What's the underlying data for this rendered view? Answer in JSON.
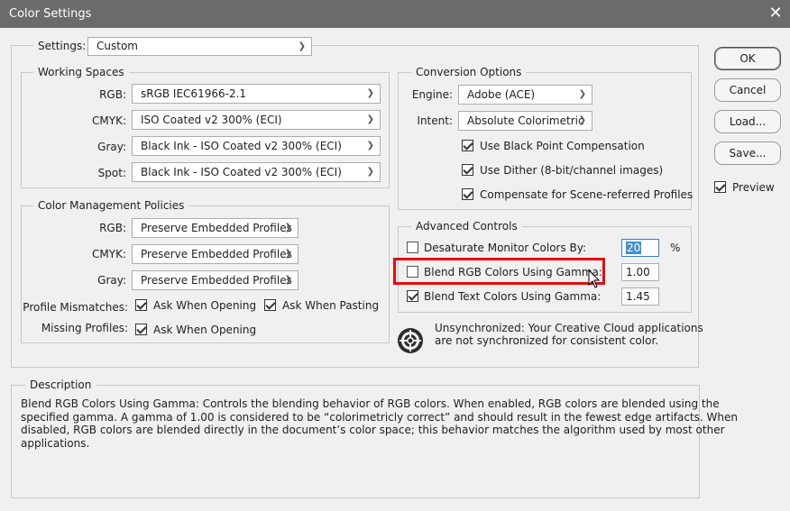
{
  "window": {
    "title": "Color Settings",
    "close_glyph": "✕"
  },
  "settings": {
    "label": "Settings:",
    "value": "Custom"
  },
  "working_spaces": {
    "legend": "Working Spaces",
    "rgb": {
      "label": "RGB:",
      "value": "sRGB IEC61966-2.1"
    },
    "cmyk": {
      "label": "CMYK:",
      "value": "ISO Coated v2 300% (ECI)"
    },
    "gray": {
      "label": "Gray:",
      "value": "Black Ink - ISO Coated v2 300% (ECI)"
    },
    "spot": {
      "label": "Spot:",
      "value": "Black Ink - ISO Coated v2 300% (ECI)"
    }
  },
  "policies": {
    "legend": "Color Management Policies",
    "rgb": {
      "label": "RGB:",
      "value": "Preserve Embedded Profiles"
    },
    "cmyk": {
      "label": "CMYK:",
      "value": "Preserve Embedded Profiles"
    },
    "gray": {
      "label": "Gray:",
      "value": "Preserve Embedded Profiles"
    },
    "mismatch_label": "Profile Mismatches:",
    "ask_opening": {
      "label": "Ask When Opening",
      "checked": true
    },
    "ask_pasting": {
      "label": "Ask When Pasting",
      "checked": true
    },
    "missing_label": "Missing Profiles:",
    "missing_opening": {
      "label": "Ask When Opening",
      "checked": true
    }
  },
  "conversion": {
    "legend": "Conversion Options",
    "engine": {
      "label": "Engine:",
      "value": "Adobe (ACE)"
    },
    "intent": {
      "label": "Intent:",
      "value": "Absolute Colorimetric"
    },
    "black_point": {
      "label": "Use Black Point Compensation",
      "checked": true
    },
    "dither": {
      "label": "Use Dither (8-bit/channel images)",
      "checked": true
    },
    "scene": {
      "label": "Compensate for Scene-referred Profiles",
      "checked": true
    }
  },
  "advanced": {
    "legend": "Advanced Controls",
    "desaturate": {
      "label": "Desaturate Monitor Colors By:",
      "checked": false,
      "value": "20",
      "unit": "%"
    },
    "blend_rgb": {
      "label": "Blend RGB Colors Using Gamma:",
      "checked": false,
      "value": "1.00"
    },
    "blend_text": {
      "label": "Blend Text Colors Using Gamma:",
      "checked": true,
      "value": "1.45"
    }
  },
  "sync": {
    "line1": "Unsynchronized: Your Creative Cloud applications",
    "line2": "are not synchronized for consistent color.",
    "icon": "sync-status-icon"
  },
  "buttons": {
    "ok": "OK",
    "cancel": "Cancel",
    "load": "Load...",
    "save": "Save..."
  },
  "preview": {
    "label": "Preview",
    "checked": true
  },
  "description": {
    "legend": "Description",
    "line1": "Blend RGB Colors Using Gamma:  Controls the blending behavior of RGB colors.  When enabled, RGB colors are blended using the",
    "line2": "specified gamma.  A gamma of 1.00 is considered to be “colorimetricly correct” and should result in the fewest edge artifacts.  When",
    "line3": "disabled, RGB colors are blended directly in the document’s color space; this behavior matches the algorithm used by most other",
    "line4": "applications."
  },
  "colors": {
    "titlebar": "#6b6b6b",
    "highlight": "#e20d0d",
    "selection": "#3d8fd6"
  }
}
